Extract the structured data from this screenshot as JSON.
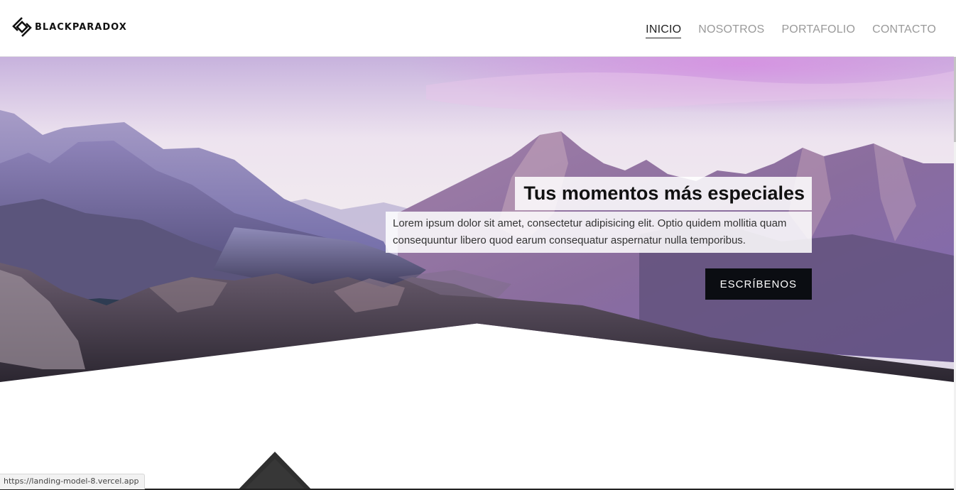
{
  "brand": {
    "name": "BLACKPARADOX"
  },
  "nav": {
    "items": [
      {
        "label": "INICIO",
        "active": true
      },
      {
        "label": "NOSOTROS",
        "active": false
      },
      {
        "label": "PORTAFOLIO",
        "active": false
      },
      {
        "label": "CONTACTO",
        "active": false
      }
    ]
  },
  "hero": {
    "title": "Tus momentos más especiales",
    "description": "Lorem ipsum dolor sit amet, consectetur adipisicing elit. Optio quidem mollitia quam consequuntur libero quod earum consequatur aspernatur nulla temporibus.",
    "cta_label": "ESCRÍBENOS"
  },
  "status_bar": {
    "url": "https://landing-model-8.vercel.app"
  },
  "colors": {
    "accent": "#0b0d12",
    "nav_inactive": "#9a9a9a",
    "nav_active": "#222222"
  },
  "icons": {
    "logo": "paradox-logo-icon"
  }
}
